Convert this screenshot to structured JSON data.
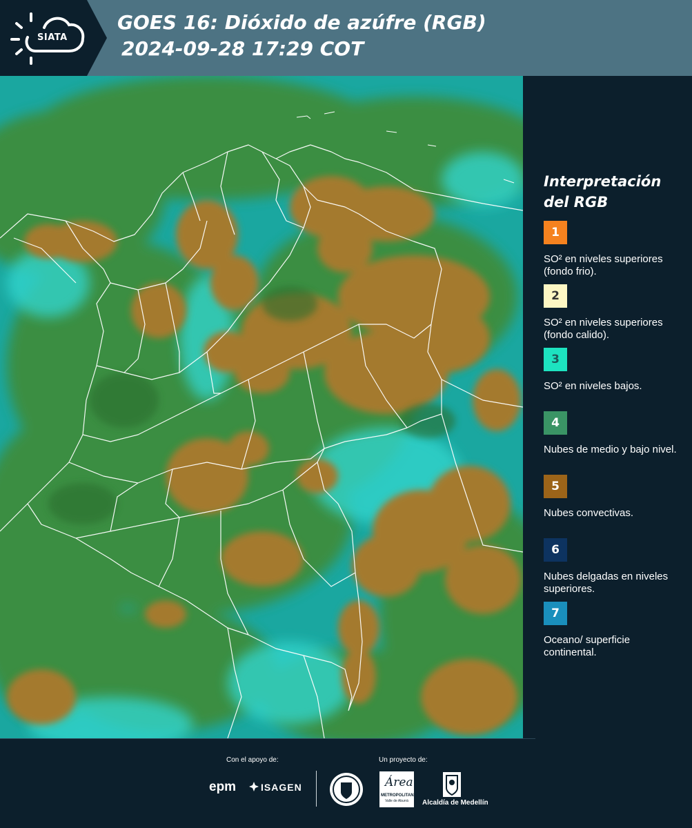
{
  "header": {
    "logo_text": "SIATA",
    "title_line1": "GOES 16: Dióxido de azúfre (RGB)",
    "title_line2": "2024-09-28 17:29 COT"
  },
  "legend": {
    "title_line1": "Interpretación",
    "title_line2": "del RGB",
    "items": [
      {
        "number": "1",
        "color": "#f5821f",
        "text_color": "#ffffff",
        "description": "SO² en niveles superiores (fondo frio)."
      },
      {
        "number": "2",
        "color": "#fdf7c4",
        "text_color": "#333333",
        "description": "SO² en niveles superiores (fondo calido)."
      },
      {
        "number": "3",
        "color": "#1de3c0",
        "text_color": "#1c5a5a",
        "description": "SO² en niveles bajos."
      },
      {
        "number": "4",
        "color": "#3a9465",
        "text_color": "#ffffff",
        "description": "Nubes de medio y bajo nivel."
      },
      {
        "number": "5",
        "color": "#9c6419",
        "text_color": "#ffffff",
        "description": "Nubes convectivas."
      },
      {
        "number": "6",
        "color": "#0d3360",
        "text_color": "#ffffff",
        "description": "Nubes delgadas en niveles superiores."
      },
      {
        "number": "7",
        "color": "#1a8fbc",
        "text_color": "#ffffff",
        "description": "Oceano/ superficie continental."
      }
    ]
  },
  "footer": {
    "support_label": "Con el apoyo de:",
    "project_label": "Un proyecto de:",
    "sponsor_epm": "epm",
    "sponsor_isagen": "ISAGEN",
    "area_logo_text": "Área",
    "area_logo_sub1": "METROPOLITANA",
    "area_logo_sub2": "Valle de Aburrá",
    "alcaldia": "Alcaldía de Medellín"
  },
  "map": {
    "icons": [
      "siata-logo-icon",
      "isagen-icon",
      "medellin-seal-icon",
      "alcaldia-shield-icon"
    ],
    "colors": {
      "background": "#0c1f2c",
      "header_band": "#4d7383",
      "map_cyan": "#1aa7a0",
      "map_green": "#3d8d3c",
      "map_brown": "#a47a2e",
      "borders": "#ffffff"
    }
  }
}
